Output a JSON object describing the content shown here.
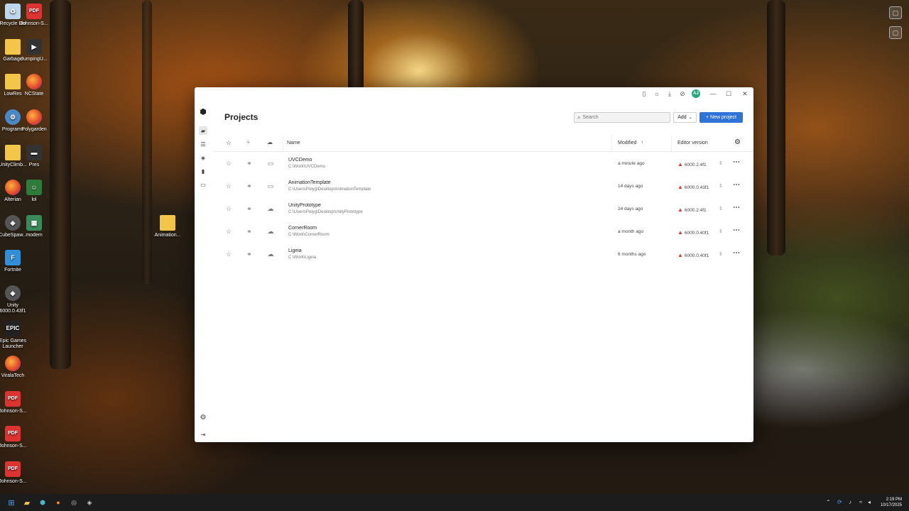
{
  "desktop": {
    "icons": [
      {
        "label": "Recycle Bin",
        "glyph": "♻",
        "kind": "recycle"
      },
      {
        "label": "Johnson-S...",
        "glyph": "PDF",
        "kind": "pdf"
      },
      {
        "label": "Garbage",
        "glyph": "",
        "kind": "folder"
      },
      {
        "label": "JumpingU...",
        "glyph": "▶",
        "kind": "video"
      },
      {
        "label": "LowRes",
        "glyph": "",
        "kind": "folder"
      },
      {
        "label": "NCState",
        "glyph": "",
        "kind": "firefox"
      },
      {
        "label": "Programs",
        "glyph": "⚙",
        "kind": "prog"
      },
      {
        "label": "Polygarden",
        "glyph": "",
        "kind": "firefox"
      },
      {
        "label": "UnityClimb...",
        "glyph": "",
        "kind": "folder"
      },
      {
        "label": "Pres",
        "glyph": "▬",
        "kind": "video"
      },
      {
        "label": "Alterian",
        "glyph": "",
        "kind": "firefox"
      },
      {
        "label": "lol",
        "glyph": "☺",
        "kind": "app"
      },
      {
        "label": "CubeSpaw...",
        "glyph": "◈",
        "kind": "unity"
      },
      {
        "label": "modem",
        "glyph": "▦",
        "kind": "modem"
      },
      {
        "label": "Animation...",
        "glyph": "",
        "kind": "folder"
      },
      {
        "label": "Fortnite",
        "glyph": "F",
        "kind": "fortnite"
      },
      {
        "label": "Unity 6000.0.43f1",
        "glyph": "◈",
        "kind": "unity"
      },
      {
        "label": "Epic Games Launcher",
        "glyph": "EPIC",
        "kind": "epic"
      },
      {
        "label": "ViralaTech",
        "glyph": "",
        "kind": "firefox"
      },
      {
        "label": "Johnson-S...",
        "glyph": "PDF",
        "kind": "pdf"
      },
      {
        "label": "Johnson-S...",
        "glyph": "PDF",
        "kind": "pdf"
      },
      {
        "label": "Johnson-S...",
        "glyph": "PDF",
        "kind": "pdf"
      }
    ]
  },
  "window": {
    "title_icons": [
      "book-icon",
      "sun-icon",
      "download-icon",
      "bell-off-icon"
    ],
    "avatar": "AJ",
    "controls": {
      "minimize": "—",
      "maximize": "☐",
      "close": "✕"
    }
  },
  "sidebar": {
    "logo": "unity-logo-icon",
    "items": [
      "projects-icon",
      "installs-icon",
      "learn-icon",
      "community-icon",
      "assets-icon"
    ],
    "settings": "gear-icon",
    "collapse": "collapse-icon"
  },
  "main": {
    "title": "Projects",
    "search_placeholder": "Search",
    "add_label": "Add",
    "new_project_label": "+ New project",
    "columns": {
      "name": "Name",
      "modified": "Modified",
      "version": "Editor version"
    },
    "projects": [
      {
        "name": "UVCDemo",
        "path": "C:\\Work\\UVCDemo",
        "modified": "a minute ago",
        "version": "6000.2.4f1"
      },
      {
        "name": "AnimationTemplate",
        "path": "C:\\Users\\Polyg\\Desktop\\AnimationTemplate",
        "modified": "14 days ago",
        "version": "6000.0.43f1"
      },
      {
        "name": "UnityPrototype",
        "path": "C:\\Users\\Polyg\\Desktop\\UnityPrototype",
        "modified": "24 days ago",
        "version": "6000.2.4f1"
      },
      {
        "name": "CornerRoom",
        "path": "C:\\Work\\CornerRoom",
        "modified": "a month ago",
        "version": "6000.0.40f1"
      },
      {
        "name": "Ligeia",
        "path": "C:\\Work\\Ligeia",
        "modified": "6 months ago",
        "version": "6000.0.40f1"
      }
    ]
  },
  "taskbar": {
    "time": "2:19 PM",
    "date": "10/17/2025"
  },
  "colors": {
    "accent": "#2f73d9",
    "warning": "#d63b2f"
  }
}
